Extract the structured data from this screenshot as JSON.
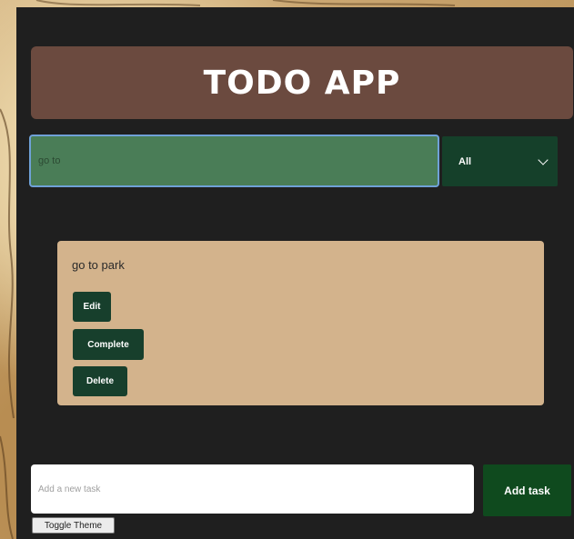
{
  "app": {
    "title": "TODO APP"
  },
  "search": {
    "value": "go to"
  },
  "filter": {
    "selected": "All"
  },
  "tasks": [
    {
      "text": "go to park",
      "edit_label": "Edit",
      "complete_label": "Complete",
      "delete_label": "Delete"
    }
  ],
  "new_task": {
    "placeholder": "Add a new task",
    "button_label": "Add task"
  },
  "toggle_theme": {
    "label": "Toggle Theme"
  },
  "colors": {
    "panel": "#1f1f1f",
    "header": "#6b4a3f",
    "search_bg": "#4a7d57",
    "filter_bg": "#15402a",
    "card": "#d3b38c",
    "button": "#173f2c",
    "add_button": "#0f4a1e"
  }
}
